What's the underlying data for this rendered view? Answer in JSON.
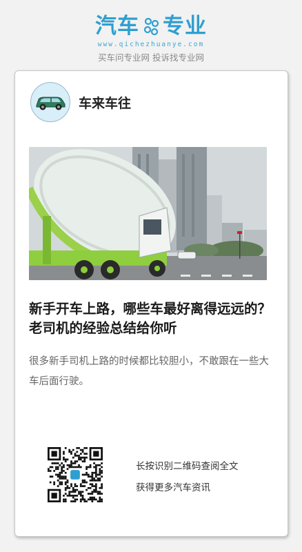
{
  "brand": {
    "logo_left": "汽车",
    "logo_right": "专业",
    "url": "www.qichezhuanye.com",
    "slogan": "买车问专业网 投诉找专业网"
  },
  "author": {
    "name": "车来车往",
    "avatar_icon": "car-avatar-icon"
  },
  "article": {
    "hero_icon": "cement-mixer-truck-photo",
    "title": "新手开车上路，哪些车最好离得远远的？老司机的经验总结给你听",
    "summary": "很多新手司机上路的时候都比较胆小，不敢跟在一些大车后面行驶。"
  },
  "qr": {
    "icon": "qr-code-icon",
    "line1": "长按识别二维码查阅全文",
    "line2": "获得更多汽车资讯"
  },
  "colors": {
    "brand_blue": "#2f9fd0",
    "background": "#f2f2f2"
  }
}
